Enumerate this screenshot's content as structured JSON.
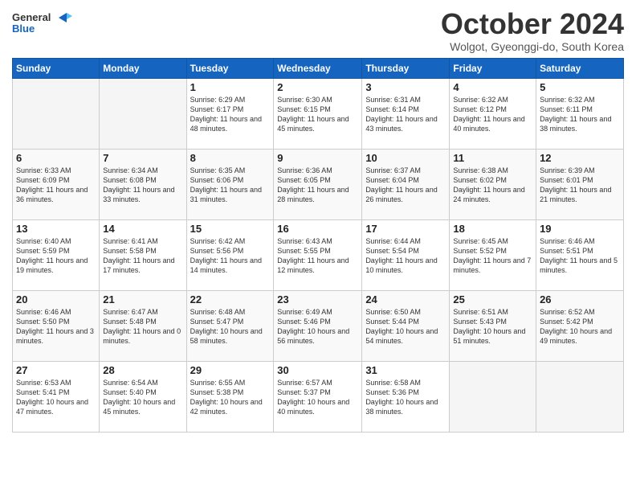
{
  "logo": {
    "general": "General",
    "blue": "Blue"
  },
  "header": {
    "month": "October 2024",
    "location": "Wolgot, Gyeonggi-do, South Korea"
  },
  "weekdays": [
    "Sunday",
    "Monday",
    "Tuesday",
    "Wednesday",
    "Thursday",
    "Friday",
    "Saturday"
  ],
  "weeks": [
    [
      {
        "day": "",
        "info": ""
      },
      {
        "day": "",
        "info": ""
      },
      {
        "day": "1",
        "info": "Sunrise: 6:29 AM\nSunset: 6:17 PM\nDaylight: 11 hours and 48 minutes."
      },
      {
        "day": "2",
        "info": "Sunrise: 6:30 AM\nSunset: 6:15 PM\nDaylight: 11 hours and 45 minutes."
      },
      {
        "day": "3",
        "info": "Sunrise: 6:31 AM\nSunset: 6:14 PM\nDaylight: 11 hours and 43 minutes."
      },
      {
        "day": "4",
        "info": "Sunrise: 6:32 AM\nSunset: 6:12 PM\nDaylight: 11 hours and 40 minutes."
      },
      {
        "day": "5",
        "info": "Sunrise: 6:32 AM\nSunset: 6:11 PM\nDaylight: 11 hours and 38 minutes."
      }
    ],
    [
      {
        "day": "6",
        "info": "Sunrise: 6:33 AM\nSunset: 6:09 PM\nDaylight: 11 hours and 36 minutes."
      },
      {
        "day": "7",
        "info": "Sunrise: 6:34 AM\nSunset: 6:08 PM\nDaylight: 11 hours and 33 minutes."
      },
      {
        "day": "8",
        "info": "Sunrise: 6:35 AM\nSunset: 6:06 PM\nDaylight: 11 hours and 31 minutes."
      },
      {
        "day": "9",
        "info": "Sunrise: 6:36 AM\nSunset: 6:05 PM\nDaylight: 11 hours and 28 minutes."
      },
      {
        "day": "10",
        "info": "Sunrise: 6:37 AM\nSunset: 6:04 PM\nDaylight: 11 hours and 26 minutes."
      },
      {
        "day": "11",
        "info": "Sunrise: 6:38 AM\nSunset: 6:02 PM\nDaylight: 11 hours and 24 minutes."
      },
      {
        "day": "12",
        "info": "Sunrise: 6:39 AM\nSunset: 6:01 PM\nDaylight: 11 hours and 21 minutes."
      }
    ],
    [
      {
        "day": "13",
        "info": "Sunrise: 6:40 AM\nSunset: 5:59 PM\nDaylight: 11 hours and 19 minutes."
      },
      {
        "day": "14",
        "info": "Sunrise: 6:41 AM\nSunset: 5:58 PM\nDaylight: 11 hours and 17 minutes."
      },
      {
        "day": "15",
        "info": "Sunrise: 6:42 AM\nSunset: 5:56 PM\nDaylight: 11 hours and 14 minutes."
      },
      {
        "day": "16",
        "info": "Sunrise: 6:43 AM\nSunset: 5:55 PM\nDaylight: 11 hours and 12 minutes."
      },
      {
        "day": "17",
        "info": "Sunrise: 6:44 AM\nSunset: 5:54 PM\nDaylight: 11 hours and 10 minutes."
      },
      {
        "day": "18",
        "info": "Sunrise: 6:45 AM\nSunset: 5:52 PM\nDaylight: 11 hours and 7 minutes."
      },
      {
        "day": "19",
        "info": "Sunrise: 6:46 AM\nSunset: 5:51 PM\nDaylight: 11 hours and 5 minutes."
      }
    ],
    [
      {
        "day": "20",
        "info": "Sunrise: 6:46 AM\nSunset: 5:50 PM\nDaylight: 11 hours and 3 minutes."
      },
      {
        "day": "21",
        "info": "Sunrise: 6:47 AM\nSunset: 5:48 PM\nDaylight: 11 hours and 0 minutes."
      },
      {
        "day": "22",
        "info": "Sunrise: 6:48 AM\nSunset: 5:47 PM\nDaylight: 10 hours and 58 minutes."
      },
      {
        "day": "23",
        "info": "Sunrise: 6:49 AM\nSunset: 5:46 PM\nDaylight: 10 hours and 56 minutes."
      },
      {
        "day": "24",
        "info": "Sunrise: 6:50 AM\nSunset: 5:44 PM\nDaylight: 10 hours and 54 minutes."
      },
      {
        "day": "25",
        "info": "Sunrise: 6:51 AM\nSunset: 5:43 PM\nDaylight: 10 hours and 51 minutes."
      },
      {
        "day": "26",
        "info": "Sunrise: 6:52 AM\nSunset: 5:42 PM\nDaylight: 10 hours and 49 minutes."
      }
    ],
    [
      {
        "day": "27",
        "info": "Sunrise: 6:53 AM\nSunset: 5:41 PM\nDaylight: 10 hours and 47 minutes."
      },
      {
        "day": "28",
        "info": "Sunrise: 6:54 AM\nSunset: 5:40 PM\nDaylight: 10 hours and 45 minutes."
      },
      {
        "day": "29",
        "info": "Sunrise: 6:55 AM\nSunset: 5:38 PM\nDaylight: 10 hours and 42 minutes."
      },
      {
        "day": "30",
        "info": "Sunrise: 6:57 AM\nSunset: 5:37 PM\nDaylight: 10 hours and 40 minutes."
      },
      {
        "day": "31",
        "info": "Sunrise: 6:58 AM\nSunset: 5:36 PM\nDaylight: 10 hours and 38 minutes."
      },
      {
        "day": "",
        "info": ""
      },
      {
        "day": "",
        "info": ""
      }
    ]
  ]
}
